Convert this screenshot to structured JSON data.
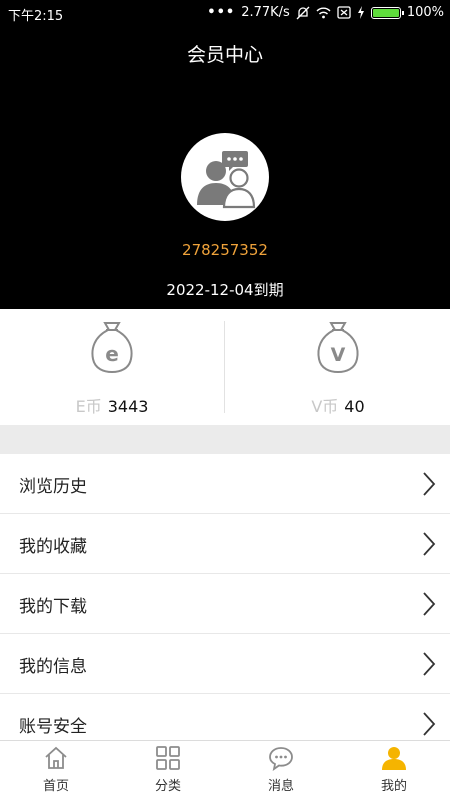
{
  "status": {
    "time": "下午2:15",
    "dots": "•••",
    "speed": "2.77K/s",
    "battery": "100%",
    "battery_level": 1.0
  },
  "header": {
    "title": "会员中心",
    "user_id": "278257352",
    "expiry": "2022-12-04到期"
  },
  "coins": [
    {
      "unit": "E币",
      "amount": "3443",
      "icon": "money-bag-e-icon",
      "letter": "e"
    },
    {
      "unit": "V币",
      "amount": "40",
      "icon": "money-bag-v-icon",
      "letter": "v"
    }
  ],
  "menu": [
    {
      "label": "浏览历史"
    },
    {
      "label": "我的收藏"
    },
    {
      "label": "我的下载"
    },
    {
      "label": "我的信息"
    },
    {
      "label": "账号安全"
    }
  ],
  "tabs": [
    {
      "label": "首页",
      "icon": "home-icon",
      "active": false
    },
    {
      "label": "分类",
      "icon": "grid-icon",
      "active": false
    },
    {
      "label": "消息",
      "icon": "chat-icon",
      "active": false
    },
    {
      "label": "我的",
      "icon": "person-icon",
      "active": true
    }
  ],
  "colors": {
    "accent": "#f0a33b",
    "active_tab": "#f5b400",
    "inactive_icon": "#8c8c8c"
  }
}
